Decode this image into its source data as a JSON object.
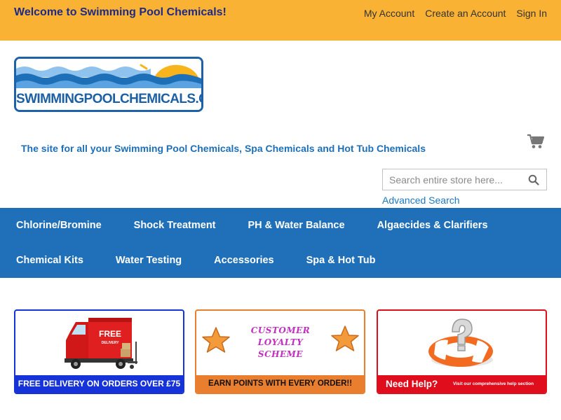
{
  "header": {
    "welcome": "Welcome to Swimming Pool Chemicals!",
    "links": [
      "My Account",
      "Create an Account",
      "Sign In"
    ]
  },
  "logo": {
    "text": "SWIMMINGPOOLCHEMICALS.CO.UK"
  },
  "tagline": "The site for all your Swimming Pool Chemicals, Spa Chemicals and Hot Tub Chemicals",
  "cart": {
    "icon": "shopping-cart-icon"
  },
  "search": {
    "placeholder": "Search entire store here...",
    "value": "",
    "icon": "search-icon",
    "advanced_label": "Advanced Search"
  },
  "nav": {
    "row1": [
      "Chlorine/Bromine",
      "Shock Treatment",
      "PH & Water Balance",
      "Algaecides & Clarifiers"
    ],
    "row2": [
      "Chemical Kits",
      "Water Testing",
      "Accessories",
      "Spa & Hot Tub"
    ]
  },
  "promos": {
    "delivery": {
      "caption": "FREE DELIVERY ON ORDERS OVER £75",
      "van_text": [
        "FREE",
        "DELIVERY"
      ]
    },
    "loyalty": {
      "title_lines": [
        "CUSTOMER",
        "LOYALTY",
        "SCHEME"
      ],
      "caption": "EARN POINTS WITH EVERY ORDER!!"
    },
    "help": {
      "title": "Need Help?",
      "subtitle": "Visit our comprehensive help section"
    }
  },
  "colors": {
    "topbar": "#f9b233",
    "nav": "#1f70b8",
    "tagline": "#1d6fb8",
    "link": "#1979c3",
    "delivery_border": "#1533d8",
    "loyalty_border": "#e87e2e",
    "help_border": "#e00d1d"
  }
}
